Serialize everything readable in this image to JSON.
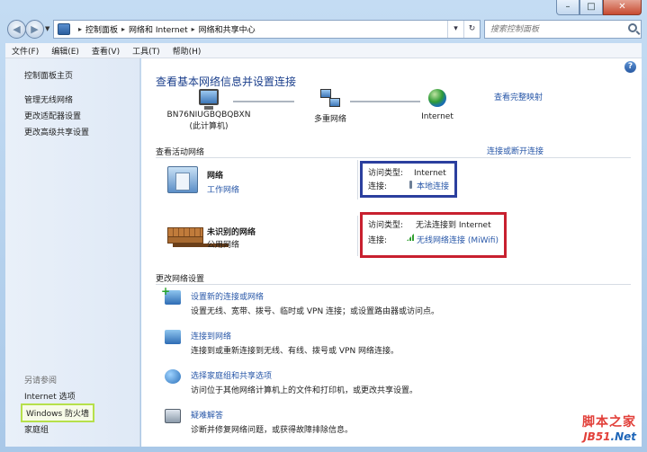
{
  "address": {
    "crumbs": [
      "控制面板",
      "网络和 Internet",
      "网络和共享中心"
    ]
  },
  "search": {
    "placeholder": "搜索控制面板"
  },
  "menu": [
    "文件(F)",
    "编辑(E)",
    "查看(V)",
    "工具(T)",
    "帮助(H)"
  ],
  "sidebar": {
    "home": "控制面板主页",
    "items": [
      "管理无线网络",
      "更改适配器设置",
      "更改高级共享设置"
    ],
    "see_also_label": "另请参阅",
    "see_also": [
      "Internet 选项",
      "Windows 防火墙",
      "家庭组"
    ]
  },
  "main": {
    "title": "查看基本网络信息并设置连接",
    "full_map": "查看完整映射",
    "map": {
      "computer_name": "BN76NIUGBQBQBXN",
      "computer_sub": "(此计算机)",
      "multi_network": "多重网络",
      "internet": "Internet"
    },
    "active_header": "查看活动网络",
    "connect_link": "连接或断开连接",
    "networks": [
      {
        "name": "网络",
        "type": "工作网络",
        "access_label": "访问类型:",
        "access_value": "Internet",
        "conn_label": "连接:",
        "conn_value": "本地连接"
      },
      {
        "name": "未识别的网络",
        "type": "公用网络",
        "access_label": "访问类型:",
        "access_value": "无法连接到 Internet",
        "conn_label": "连接:",
        "conn_value": "无线网络连接 (MiWifi)"
      }
    ],
    "change_header": "更改网络设置",
    "tasks": [
      {
        "link": "设置新的连接或网络",
        "desc": "设置无线、宽带、拨号、临时或 VPN 连接；或设置路由器或访问点。"
      },
      {
        "link": "连接到网络",
        "desc": "连接到或重新连接到无线、有线、拨号或 VPN 网络连接。"
      },
      {
        "link": "选择家庭组和共享选项",
        "desc": "访问位于其他网络计算机上的文件和打印机，或更改共享设置。"
      },
      {
        "link": "疑难解答",
        "desc": "诊断并修复网络问题，或获得故障排除信息。"
      }
    ]
  },
  "watermark": {
    "line1": "脚本之家",
    "line2a": "JB51",
    "line2b": ".Net"
  },
  "colors": {
    "link": "#2857a8",
    "title": "#1b3f8c",
    "blue_box": "#2b3f9e",
    "red_box": "#c8202f",
    "green_box": "#b6e04b"
  }
}
